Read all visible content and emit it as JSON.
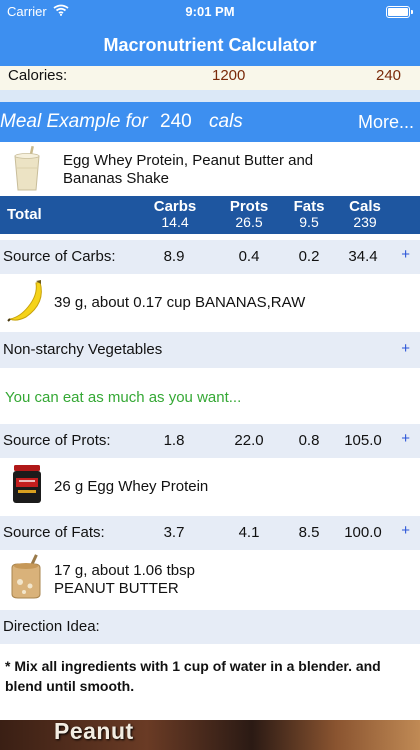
{
  "status_bar": {
    "carrier": "Carrier",
    "time": "9:01 PM"
  },
  "nav": {
    "title": "Macronutrient Calculator"
  },
  "calories": {
    "label": "Calories:",
    "daily": "1200",
    "meal": "240"
  },
  "meal_header": {
    "title": "Meal Example for",
    "cals": "240",
    "unit": "cals",
    "more": "More..."
  },
  "meal": {
    "name": "Egg Whey Protein, Peanut Butter and Bananas Shake"
  },
  "totals": {
    "label": "Total",
    "columns": [
      {
        "header": "Carbs",
        "value": "14.4"
      },
      {
        "header": "Prots",
        "value": "26.5"
      },
      {
        "header": "Fats",
        "value": "9.5"
      },
      {
        "header": "Cals",
        "value": "239"
      }
    ]
  },
  "carbs": {
    "label": "Source of Carbs:",
    "values": [
      "8.9",
      "0.4",
      "0.2",
      "34.4"
    ],
    "plus": "+",
    "food": "39 g, about 0.17 cup  BANANAS,RAW"
  },
  "vegetables": {
    "label": "Non-starchy Vegetables",
    "plus": "+",
    "note": "You can eat as much as you want..."
  },
  "prots": {
    "label": "Source of Prots:",
    "values": [
      "1.8",
      "22.0",
      "0.8",
      "105.0"
    ],
    "plus": "+",
    "food": "26 g  Egg Whey Protein"
  },
  "fats": {
    "label": "Source of Fats:",
    "values": [
      "3.7",
      "4.1",
      "8.5",
      "100.0"
    ],
    "plus": "+",
    "food_line1": "17 g, about 1.06 tbsp",
    "food_line2": "PEANUT BUTTER"
  },
  "direction": {
    "label": "Direction Idea:",
    "text": "* Mix all ingredients with 1 cup of water in a blender. and blend until smooth."
  },
  "photo": {
    "caption": "Peanut"
  },
  "icons": {
    "wifi": "wifi-icon",
    "battery": "battery-icon",
    "shake": "shake-icon",
    "banana": "banana-icon",
    "protein": "protein-tub-icon",
    "peanut": "peanut-butter-jar-icon"
  },
  "colors": {
    "accent": "#3d8ff0",
    "totals_bar": "#1e56a0",
    "row_bg": "#e6ecf6",
    "note_green": "#35a835",
    "plus_blue": "#2a55d8",
    "calorie_value": "#7a2a0a"
  }
}
